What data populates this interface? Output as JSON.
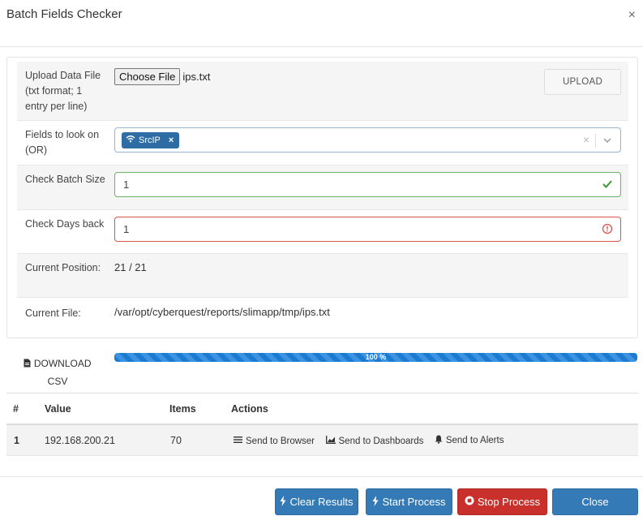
{
  "modal": {
    "title": "Batch Fields Checker",
    "close_glyph": "×"
  },
  "form": {
    "upload": {
      "label": "Upload Data File (txt format; 1 entry per line)",
      "choose_button": "Choose File",
      "file_name": "ips.txt",
      "upload_button": "UPLOAD"
    },
    "fields": {
      "label": "Fields to look on (OR)",
      "chips": [
        {
          "label": "SrcIP",
          "icon": "wifi-icon",
          "remove": "×"
        }
      ],
      "clear_glyph": "×"
    },
    "batch_size": {
      "label": "Check Batch Size",
      "value": "1",
      "status": "valid"
    },
    "days_back": {
      "label": "Check Days back",
      "value": "1",
      "status": "invalid"
    },
    "position": {
      "label": "Current Position:",
      "value": "21 / 21"
    },
    "current_file": {
      "label": "Current File:",
      "value": "/var/opt/cyberquest/reports/slimapp/tmp/ips.txt"
    }
  },
  "download": {
    "label": "DOWNLOAD CSV",
    "icon": "file-icon"
  },
  "progress": {
    "percent": 100,
    "label": "100 %"
  },
  "results": {
    "columns": [
      "#",
      "Value",
      "Items",
      "Actions"
    ],
    "rows": [
      {
        "index": "1",
        "value": "192.168.200.21",
        "items": "70",
        "actions": [
          {
            "label": "Send to Browser",
            "icon": "list-icon"
          },
          {
            "label": "Send to Dashboards",
            "icon": "chart-icon"
          },
          {
            "label": "Send to Alerts",
            "icon": "bell-icon"
          }
        ]
      }
    ]
  },
  "footer": {
    "clear_results": "Clear Results",
    "start_process": "Start Process",
    "stop_process": "Stop Process",
    "close": "Close"
  },
  "colors": {
    "primary": "#337ab7",
    "danger": "#c9302c",
    "success": "#5cb85c",
    "error": "#d9534f"
  }
}
